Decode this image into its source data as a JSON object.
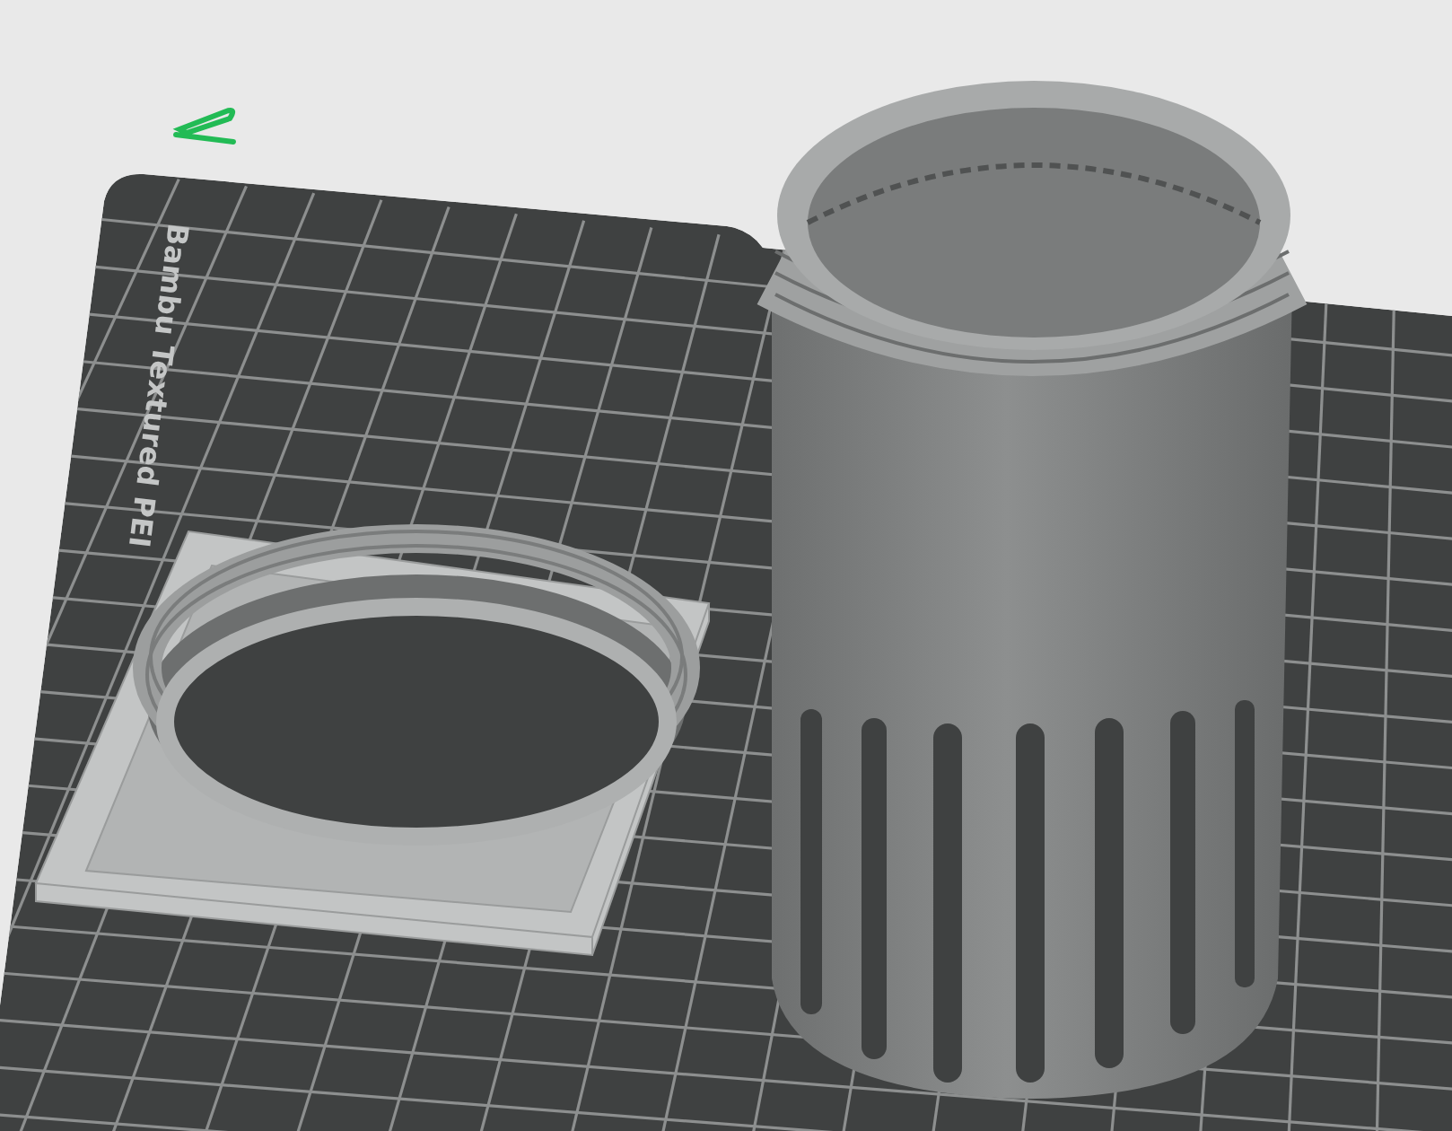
{
  "viewport": {
    "plate": {
      "label": "Bambu Textured PEI"
    }
  }
}
